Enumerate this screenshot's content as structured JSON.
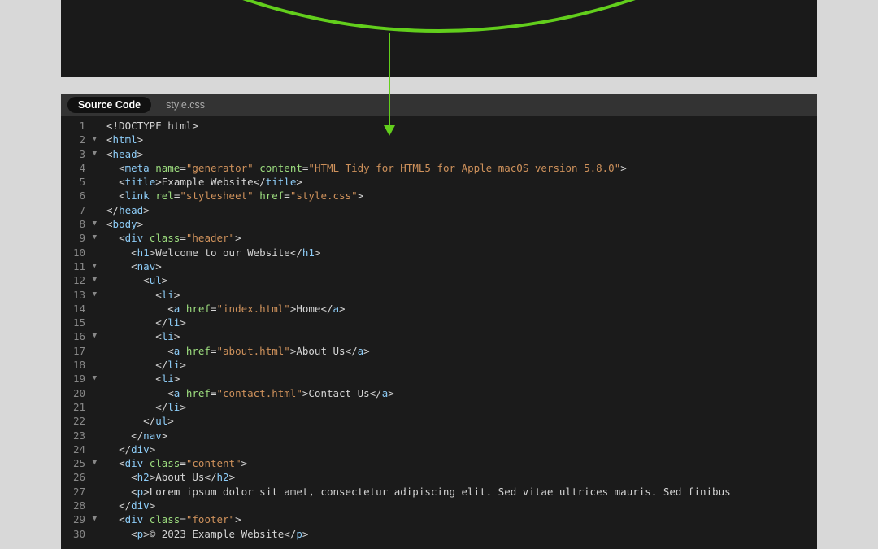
{
  "tabs": {
    "active": "Source Code",
    "inactive": "style.css"
  },
  "lines": [
    {
      "num": 1,
      "fold": "",
      "indent": 0,
      "tokens": [
        {
          "t": "doctype",
          "v": "<!DOCTYPE html>"
        }
      ]
    },
    {
      "num": 2,
      "fold": "▼",
      "indent": 0,
      "tokens": [
        {
          "t": "punc",
          "v": "<"
        },
        {
          "t": "tagname",
          "v": "html"
        },
        {
          "t": "punc",
          "v": ">"
        }
      ]
    },
    {
      "num": 3,
      "fold": "▼",
      "indent": 0,
      "tokens": [
        {
          "t": "punc",
          "v": "<"
        },
        {
          "t": "tagname",
          "v": "head"
        },
        {
          "t": "punc",
          "v": ">"
        }
      ]
    },
    {
      "num": 4,
      "fold": "",
      "indent": 1,
      "tokens": [
        {
          "t": "punc",
          "v": "<"
        },
        {
          "t": "tagname",
          "v": "meta"
        },
        {
          "t": "punc",
          "v": " "
        },
        {
          "t": "attrname",
          "v": "name"
        },
        {
          "t": "punc",
          "v": "="
        },
        {
          "t": "attrval",
          "v": "\"generator\""
        },
        {
          "t": "punc",
          "v": " "
        },
        {
          "t": "attrname",
          "v": "content"
        },
        {
          "t": "punc",
          "v": "="
        },
        {
          "t": "attrval",
          "v": "\"HTML Tidy for HTML5 for Apple macOS version 5.8.0\""
        },
        {
          "t": "punc",
          "v": ">"
        }
      ]
    },
    {
      "num": 5,
      "fold": "",
      "indent": 1,
      "tokens": [
        {
          "t": "punc",
          "v": "<"
        },
        {
          "t": "tagname",
          "v": "title"
        },
        {
          "t": "punc",
          "v": ">"
        },
        {
          "t": "text",
          "v": "Example Website"
        },
        {
          "t": "punc",
          "v": "</"
        },
        {
          "t": "tagname",
          "v": "title"
        },
        {
          "t": "punc",
          "v": ">"
        }
      ]
    },
    {
      "num": 6,
      "fold": "",
      "indent": 1,
      "tokens": [
        {
          "t": "punc",
          "v": "<"
        },
        {
          "t": "tagname",
          "v": "link"
        },
        {
          "t": "punc",
          "v": " "
        },
        {
          "t": "attrname",
          "v": "rel"
        },
        {
          "t": "punc",
          "v": "="
        },
        {
          "t": "attrval",
          "v": "\"stylesheet\""
        },
        {
          "t": "punc",
          "v": " "
        },
        {
          "t": "attrname",
          "v": "href"
        },
        {
          "t": "punc",
          "v": "="
        },
        {
          "t": "attrval",
          "v": "\"style.css\""
        },
        {
          "t": "punc",
          "v": ">"
        }
      ]
    },
    {
      "num": 7,
      "fold": "",
      "indent": 0,
      "tokens": [
        {
          "t": "punc",
          "v": "</"
        },
        {
          "t": "tagname",
          "v": "head"
        },
        {
          "t": "punc",
          "v": ">"
        }
      ]
    },
    {
      "num": 8,
      "fold": "▼",
      "indent": 0,
      "tokens": [
        {
          "t": "punc",
          "v": "<"
        },
        {
          "t": "tagname",
          "v": "body"
        },
        {
          "t": "punc",
          "v": ">"
        }
      ]
    },
    {
      "num": 9,
      "fold": "▼",
      "indent": 1,
      "tokens": [
        {
          "t": "punc",
          "v": "<"
        },
        {
          "t": "tagname",
          "v": "div"
        },
        {
          "t": "punc",
          "v": " "
        },
        {
          "t": "attrname",
          "v": "class"
        },
        {
          "t": "punc",
          "v": "="
        },
        {
          "t": "attrval",
          "v": "\"header\""
        },
        {
          "t": "punc",
          "v": ">"
        }
      ]
    },
    {
      "num": 10,
      "fold": "",
      "indent": 2,
      "tokens": [
        {
          "t": "punc",
          "v": "<"
        },
        {
          "t": "tagname",
          "v": "h1"
        },
        {
          "t": "punc",
          "v": ">"
        },
        {
          "t": "text",
          "v": "Welcome to our Website"
        },
        {
          "t": "punc",
          "v": "</"
        },
        {
          "t": "tagname",
          "v": "h1"
        },
        {
          "t": "punc",
          "v": ">"
        }
      ]
    },
    {
      "num": 11,
      "fold": "▼",
      "indent": 2,
      "tokens": [
        {
          "t": "punc",
          "v": "<"
        },
        {
          "t": "tagname",
          "v": "nav"
        },
        {
          "t": "punc",
          "v": ">"
        }
      ]
    },
    {
      "num": 12,
      "fold": "▼",
      "indent": 3,
      "tokens": [
        {
          "t": "punc",
          "v": "<"
        },
        {
          "t": "tagname",
          "v": "ul"
        },
        {
          "t": "punc",
          "v": ">"
        }
      ]
    },
    {
      "num": 13,
      "fold": "▼",
      "indent": 4,
      "tokens": [
        {
          "t": "punc",
          "v": "<"
        },
        {
          "t": "tagname",
          "v": "li"
        },
        {
          "t": "punc",
          "v": ">"
        }
      ]
    },
    {
      "num": 14,
      "fold": "",
      "indent": 5,
      "tokens": [
        {
          "t": "punc",
          "v": "<"
        },
        {
          "t": "tagname",
          "v": "a"
        },
        {
          "t": "punc",
          "v": " "
        },
        {
          "t": "attrname",
          "v": "href"
        },
        {
          "t": "punc",
          "v": "="
        },
        {
          "t": "attrval",
          "v": "\"index.html\""
        },
        {
          "t": "punc",
          "v": ">"
        },
        {
          "t": "text",
          "v": "Home"
        },
        {
          "t": "punc",
          "v": "</"
        },
        {
          "t": "tagname",
          "v": "a"
        },
        {
          "t": "punc",
          "v": ">"
        }
      ]
    },
    {
      "num": 15,
      "fold": "",
      "indent": 4,
      "tokens": [
        {
          "t": "punc",
          "v": "</"
        },
        {
          "t": "tagname",
          "v": "li"
        },
        {
          "t": "punc",
          "v": ">"
        }
      ]
    },
    {
      "num": 16,
      "fold": "▼",
      "indent": 4,
      "tokens": [
        {
          "t": "punc",
          "v": "<"
        },
        {
          "t": "tagname",
          "v": "li"
        },
        {
          "t": "punc",
          "v": ">"
        }
      ]
    },
    {
      "num": 17,
      "fold": "",
      "indent": 5,
      "tokens": [
        {
          "t": "punc",
          "v": "<"
        },
        {
          "t": "tagname",
          "v": "a"
        },
        {
          "t": "punc",
          "v": " "
        },
        {
          "t": "attrname",
          "v": "href"
        },
        {
          "t": "punc",
          "v": "="
        },
        {
          "t": "attrval",
          "v": "\"about.html\""
        },
        {
          "t": "punc",
          "v": ">"
        },
        {
          "t": "text",
          "v": "About Us"
        },
        {
          "t": "punc",
          "v": "</"
        },
        {
          "t": "tagname",
          "v": "a"
        },
        {
          "t": "punc",
          "v": ">"
        }
      ]
    },
    {
      "num": 18,
      "fold": "",
      "indent": 4,
      "tokens": [
        {
          "t": "punc",
          "v": "</"
        },
        {
          "t": "tagname",
          "v": "li"
        },
        {
          "t": "punc",
          "v": ">"
        }
      ]
    },
    {
      "num": 19,
      "fold": "▼",
      "indent": 4,
      "tokens": [
        {
          "t": "punc",
          "v": "<"
        },
        {
          "t": "tagname",
          "v": "li"
        },
        {
          "t": "punc",
          "v": ">"
        }
      ]
    },
    {
      "num": 20,
      "fold": "",
      "indent": 5,
      "tokens": [
        {
          "t": "punc",
          "v": "<"
        },
        {
          "t": "tagname",
          "v": "a"
        },
        {
          "t": "punc",
          "v": " "
        },
        {
          "t": "attrname",
          "v": "href"
        },
        {
          "t": "punc",
          "v": "="
        },
        {
          "t": "attrval",
          "v": "\"contact.html\""
        },
        {
          "t": "punc",
          "v": ">"
        },
        {
          "t": "text",
          "v": "Contact Us"
        },
        {
          "t": "punc",
          "v": "</"
        },
        {
          "t": "tagname",
          "v": "a"
        },
        {
          "t": "punc",
          "v": ">"
        }
      ]
    },
    {
      "num": 21,
      "fold": "",
      "indent": 4,
      "tokens": [
        {
          "t": "punc",
          "v": "</"
        },
        {
          "t": "tagname",
          "v": "li"
        },
        {
          "t": "punc",
          "v": ">"
        }
      ]
    },
    {
      "num": 22,
      "fold": "",
      "indent": 3,
      "tokens": [
        {
          "t": "punc",
          "v": "</"
        },
        {
          "t": "tagname",
          "v": "ul"
        },
        {
          "t": "punc",
          "v": ">"
        }
      ]
    },
    {
      "num": 23,
      "fold": "",
      "indent": 2,
      "tokens": [
        {
          "t": "punc",
          "v": "</"
        },
        {
          "t": "tagname",
          "v": "nav"
        },
        {
          "t": "punc",
          "v": ">"
        }
      ]
    },
    {
      "num": 24,
      "fold": "",
      "indent": 1,
      "tokens": [
        {
          "t": "punc",
          "v": "</"
        },
        {
          "t": "tagname",
          "v": "div"
        },
        {
          "t": "punc",
          "v": ">"
        }
      ]
    },
    {
      "num": 25,
      "fold": "▼",
      "indent": 1,
      "tokens": [
        {
          "t": "punc",
          "v": "<"
        },
        {
          "t": "tagname",
          "v": "div"
        },
        {
          "t": "punc",
          "v": " "
        },
        {
          "t": "attrname",
          "v": "class"
        },
        {
          "t": "punc",
          "v": "="
        },
        {
          "t": "attrval",
          "v": "\"content\""
        },
        {
          "t": "punc",
          "v": ">"
        }
      ]
    },
    {
      "num": 26,
      "fold": "",
      "indent": 2,
      "tokens": [
        {
          "t": "punc",
          "v": "<"
        },
        {
          "t": "tagname",
          "v": "h2"
        },
        {
          "t": "punc",
          "v": ">"
        },
        {
          "t": "text",
          "v": "About Us"
        },
        {
          "t": "punc",
          "v": "</"
        },
        {
          "t": "tagname",
          "v": "h2"
        },
        {
          "t": "punc",
          "v": ">"
        }
      ]
    },
    {
      "num": 27,
      "fold": "",
      "indent": 2,
      "tokens": [
        {
          "t": "punc",
          "v": "<"
        },
        {
          "t": "tagname",
          "v": "p"
        },
        {
          "t": "punc",
          "v": ">"
        },
        {
          "t": "text",
          "v": "Lorem ipsum dolor sit amet, consectetur adipiscing elit. Sed vitae ultrices mauris. Sed finibus"
        }
      ]
    },
    {
      "num": 28,
      "fold": "",
      "indent": 1,
      "tokens": [
        {
          "t": "punc",
          "v": "</"
        },
        {
          "t": "tagname",
          "v": "div"
        },
        {
          "t": "punc",
          "v": ">"
        }
      ]
    },
    {
      "num": 29,
      "fold": "▼",
      "indent": 1,
      "tokens": [
        {
          "t": "punc",
          "v": "<"
        },
        {
          "t": "tagname",
          "v": "div"
        },
        {
          "t": "punc",
          "v": " "
        },
        {
          "t": "attrname",
          "v": "class"
        },
        {
          "t": "punc",
          "v": "="
        },
        {
          "t": "attrval",
          "v": "\"footer\""
        },
        {
          "t": "punc",
          "v": ">"
        }
      ]
    },
    {
      "num": 30,
      "fold": "",
      "indent": 2,
      "tokens": [
        {
          "t": "punc",
          "v": "<"
        },
        {
          "t": "tagname",
          "v": "p"
        },
        {
          "t": "punc",
          "v": ">"
        },
        {
          "t": "text",
          "v": "© 2023 Example Website"
        },
        {
          "t": "punc",
          "v": "</"
        },
        {
          "t": "tagname",
          "v": "p"
        },
        {
          "t": "punc",
          "v": ">"
        }
      ]
    }
  ]
}
